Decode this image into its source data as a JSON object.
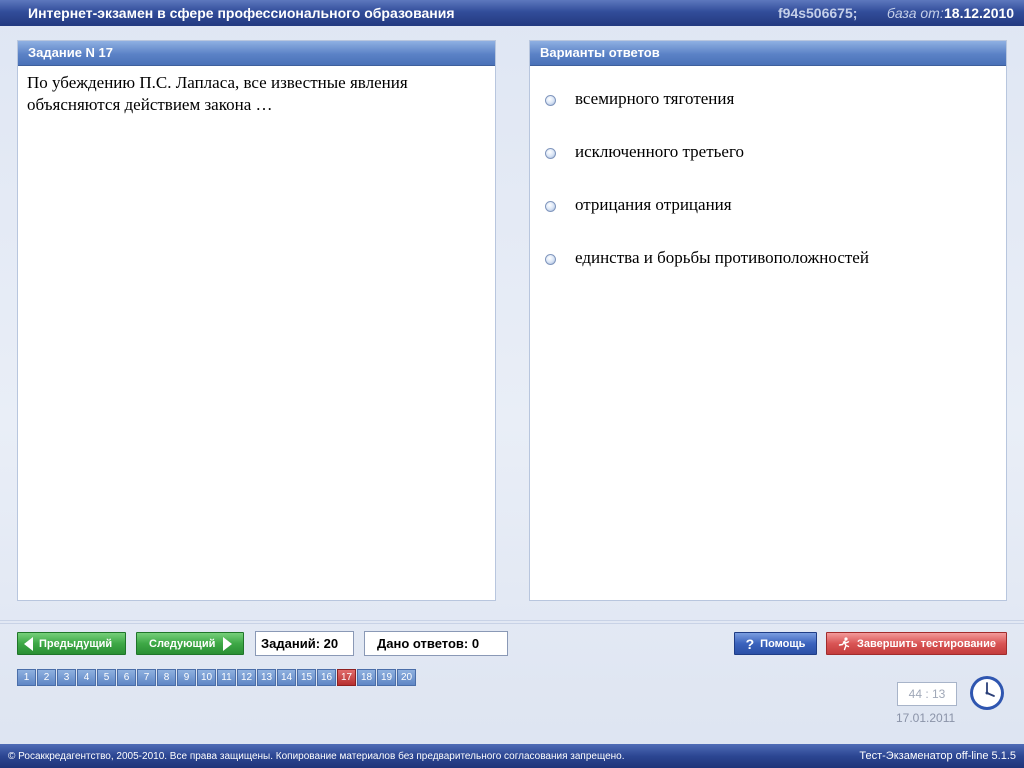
{
  "header": {
    "title": "Интернет-экзамен в сфере профессионального образования",
    "user_id": "f94s506675;",
    "base_label": "база от:",
    "base_date": "18.12.2010"
  },
  "task": {
    "header": "Задание N 17",
    "question": "По убеждению П.С. Лапласа, все известные явления объясняются действием закона …"
  },
  "answers": {
    "header": "Варианты ответов",
    "options": [
      "всемирного тяготения",
      "исключенного третьего",
      "отрицания отрицания",
      "единства и борьбы противоположностей"
    ]
  },
  "nav": {
    "prev_label": "Предыдущий",
    "next_label": "Следующий",
    "tasks_count": "Заданий: 20",
    "answers_given": "Дано ответов: 0",
    "help_label": "Помощь",
    "finish_label": "Завершить тестирование"
  },
  "pages": [
    "1",
    "2",
    "3",
    "4",
    "5",
    "6",
    "7",
    "8",
    "9",
    "10",
    "11",
    "12",
    "13",
    "14",
    "15",
    "16",
    "17",
    "18",
    "19",
    "20"
  ],
  "current_page": "17",
  "timer": "44 : 13",
  "date": "17.01.2011",
  "footer": {
    "copyright": "© Росаккредагентство, 2005-2010. Все права защищены. Копирование материалов без предварительного согласования запрещено.",
    "version": "Тест-Экзаменатор off-line 5.1.5"
  },
  "colors": {
    "title_bar": "#324d9a",
    "panel_header": "#5b82c6",
    "nav_green": "#3ea846",
    "finish_red": "#d95555",
    "help_blue": "#3b63bd",
    "active_page": "#b72f2f"
  }
}
